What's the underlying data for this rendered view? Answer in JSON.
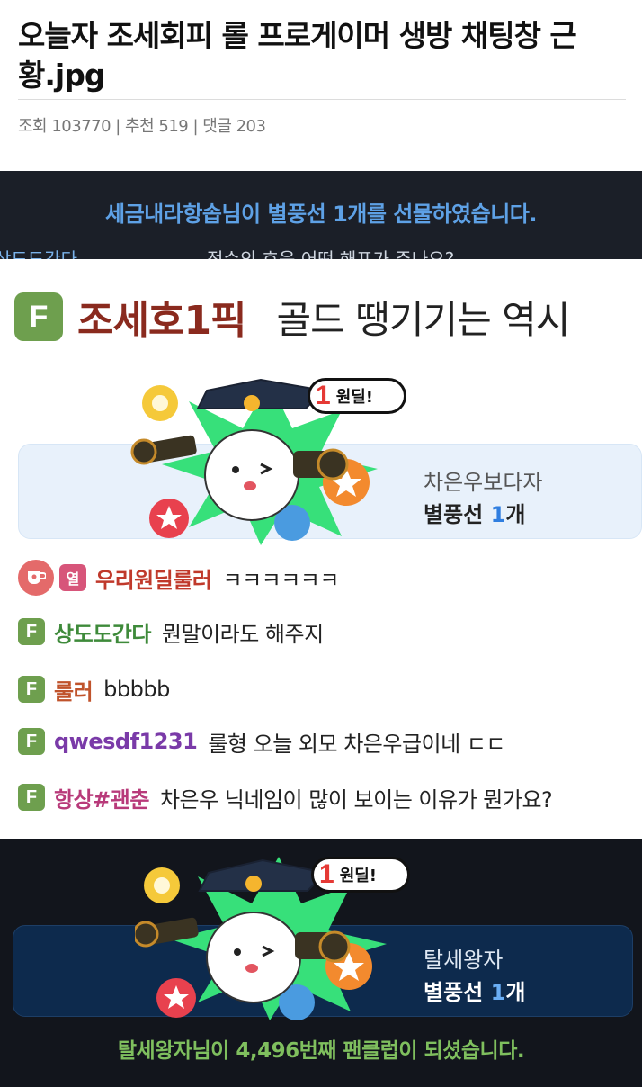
{
  "post": {
    "title": "오늘자 조세회피 롤 프로게이머 생방 채팅창 근황.jpg",
    "meta": "조회 103770 | 추천 519 | 댓글 203"
  },
  "broadcast_top": {
    "gift_notice": "세금내라항솝님이 별풍선 1개를 선물하였습니다.",
    "cut_chat_name": "상도도간다",
    "cut_chat_text": "정수의 흐음 어떤 해프가 주나요?"
  },
  "fan_message": {
    "badge": "F",
    "name": "조세호1픽",
    "text": "골드 땡기기는 역시"
  },
  "donation_light": {
    "deal_label": "1 원딜!",
    "donor": "차은우보다자",
    "amount_prefix": "별풍선 ",
    "amount_num": "1",
    "amount_suffix": "개"
  },
  "chat": [
    {
      "badge": "cup",
      "badge2": "열",
      "name": "우리원딜룰러",
      "name_color": "#c0392b",
      "text": "ㅋㅋㅋㅋㅋㅋ"
    },
    {
      "badge": "F",
      "name": "상도도간다",
      "name_color": "#3e8a3a",
      "text": "뭔말이라도 해주지"
    },
    {
      "badge": "F",
      "name": "룰러",
      "name_color": "#c0532b",
      "text": "bbbbb"
    },
    {
      "badge": "F",
      "name": "qwesdf1231",
      "name_color": "#7a3aa8",
      "text": "룰형 오늘 외모 차은우급이네 ㄷㄷ"
    },
    {
      "badge": "F",
      "name": "항상#괜춘",
      "name_color": "#b83a7a",
      "text": "차은우 닉네임이 많이 보이는 이유가 뭔가요?"
    }
  ],
  "donation_dark": {
    "deal_label": "1 원딜!",
    "donor": "탈세왕자",
    "amount_prefix": "별풍선 ",
    "amount_num": "1",
    "amount_suffix": "개"
  },
  "fanclub_notice": "탈세왕자님이 4,496번째 팬클럽이 되셨습니다.",
  "colors": {
    "fan_badge": "#6e9f4e",
    "gift_blue": "#5ea1e6",
    "fanclub_green": "#7fbf5e",
    "burst_green": "#37e07a"
  }
}
